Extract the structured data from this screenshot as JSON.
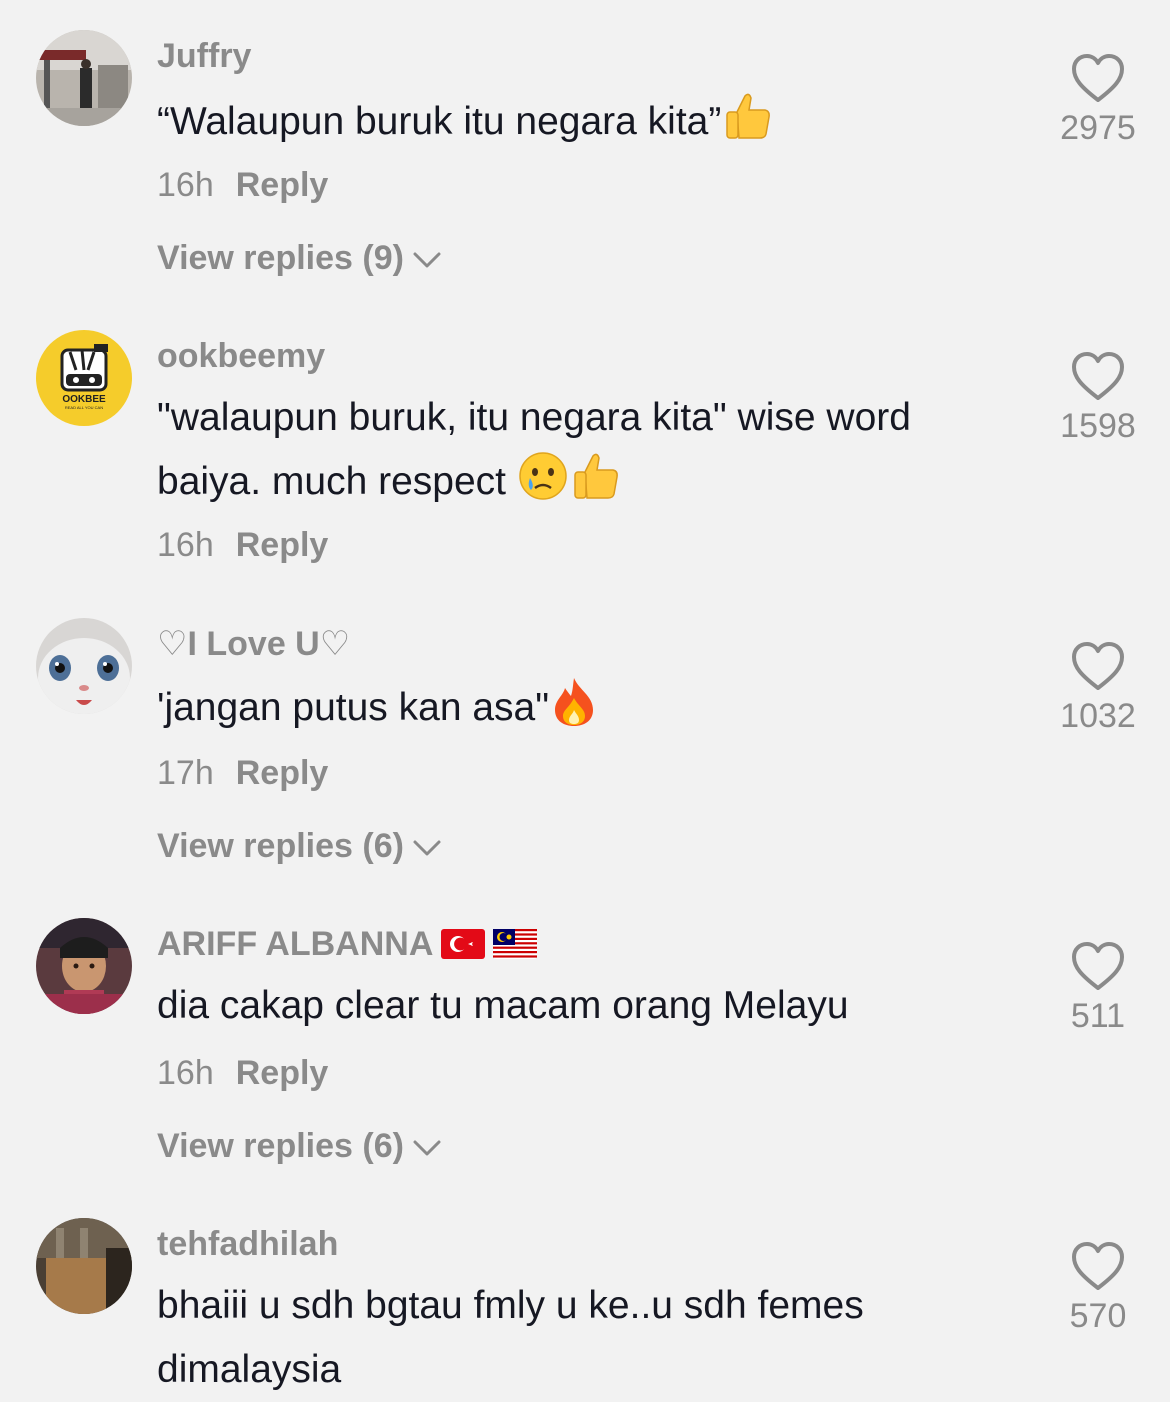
{
  "comments": [
    {
      "username": "Juffry",
      "text": "“Walaupun buruk itu negara kita”",
      "time": "16h",
      "reply_label": "Reply",
      "view_replies": "View replies (9)",
      "likes": "2975",
      "emojis": [
        "thumbs-up"
      ]
    },
    {
      "username": "ookbeemy",
      "text": "\"walaupun buruk, itu negara kita\" wise word baiya. much respect",
      "time": "16h",
      "reply_label": "Reply",
      "likes": "1598",
      "emojis": [
        "crying-face",
        "thumbs-up"
      ],
      "avatar_logo": "OOKBEE",
      "avatar_tagline": "READ ALL YOU CAN"
    },
    {
      "username": "♡I Love U♡",
      "text": "'jangan putus kan asa\"",
      "time": "17h",
      "reply_label": "Reply",
      "view_replies": "View replies (6)",
      "likes": "1032",
      "emojis": [
        "fire"
      ]
    },
    {
      "username": "ARIFF ALBANNA",
      "text": "dia cakap clear tu macam orang Melayu",
      "time": "16h",
      "reply_label": "Reply",
      "view_replies": "View replies (6)",
      "likes": "511",
      "flags": [
        "turkey-flag",
        "malaysia-flag"
      ]
    },
    {
      "username": "tehfadhilah",
      "text": "bhaiii u sdh bgtau fmly u ke..u sdh femes dimalaysia",
      "likes": "570"
    }
  ],
  "colors": {
    "background": "#f2f2f2",
    "text": "#161823",
    "secondary": "#8a8a8a",
    "avatar_ookbee": "#f5cc2b"
  }
}
